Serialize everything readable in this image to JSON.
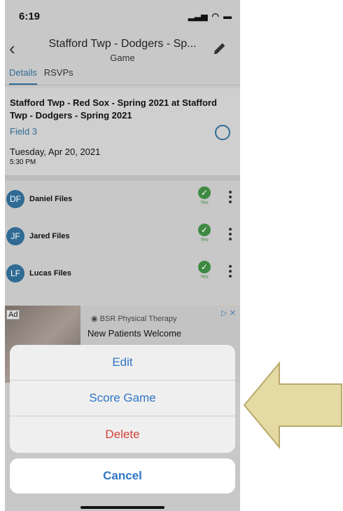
{
  "status": {
    "time": "6:19"
  },
  "nav": {
    "title": "Stafford Twp - Dodgers - Sp...",
    "subtitle": "Game"
  },
  "tabs": [
    {
      "label": "Details"
    },
    {
      "label": "RSVPs"
    }
  ],
  "game": {
    "title": "Stafford Twp - Red Sox - Spring 2021 at Stafford Twp - Dodgers - Spring 2021",
    "field": "Field 3",
    "date": "Tuesday, Apr 20, 2021",
    "time": "5:30 PM"
  },
  "players": [
    {
      "initials": "DF",
      "name": "Daniel Files",
      "rsvp": "Yes"
    },
    {
      "initials": "JF",
      "name": "Jared Files",
      "rsvp": "Yes"
    },
    {
      "initials": "LF",
      "name": "Lucas Files",
      "rsvp": "Yes"
    }
  ],
  "ad": {
    "badge": "Ad",
    "advertiser": "BSR Physical Therapy",
    "headline": "New Patients Welcome"
  },
  "action_sheet": {
    "edit": "Edit",
    "score": "Score Game",
    "delete": "Delete",
    "cancel": "Cancel"
  },
  "colors": {
    "accent": "#2f76c5",
    "destructive": "#d0413a",
    "rsvp_yes": "#3f8a42",
    "arrow_fill": "#e4daa4"
  }
}
